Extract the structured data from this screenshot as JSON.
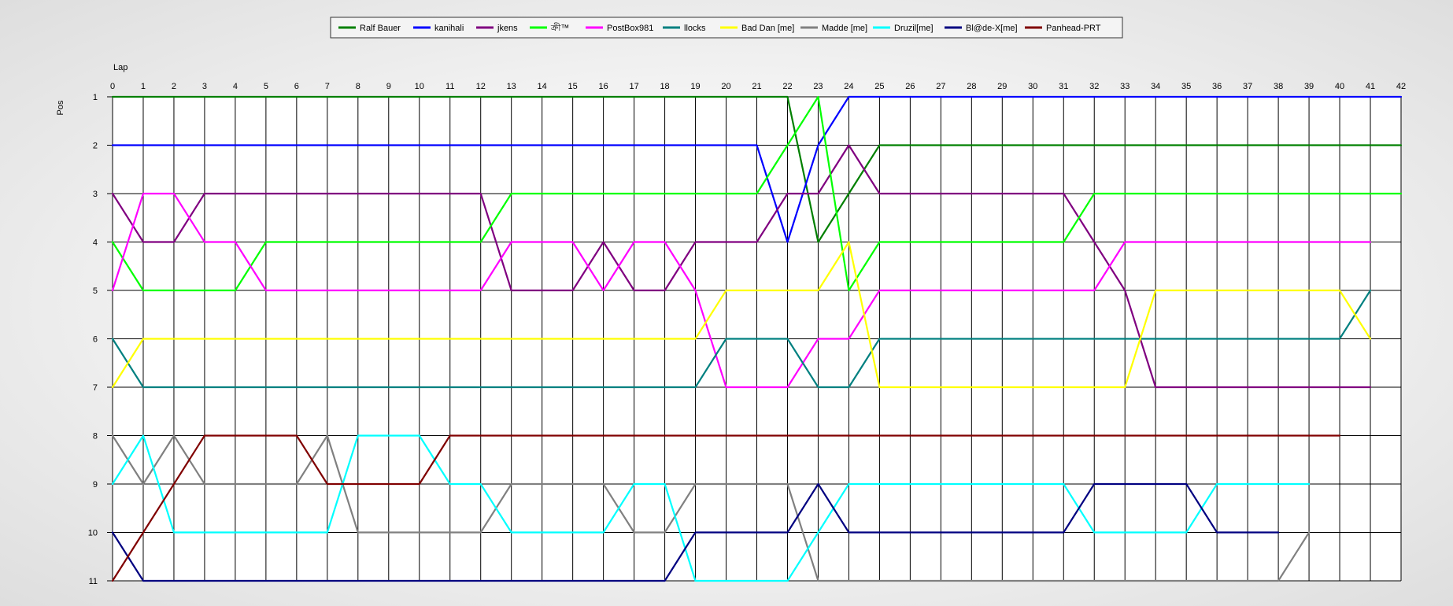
{
  "chart_data": {
    "type": "line",
    "title": "",
    "xlabel": "Lap",
    "ylabel": "Pos",
    "x_ticks": [
      0,
      1,
      2,
      3,
      4,
      5,
      6,
      7,
      8,
      9,
      10,
      11,
      12,
      13,
      14,
      15,
      16,
      17,
      18,
      19,
      20,
      21,
      22,
      23,
      24,
      25,
      26,
      27,
      28,
      29,
      30,
      31,
      32,
      33,
      34,
      35,
      36,
      37,
      38,
      39,
      40,
      41,
      42
    ],
    "y_ticks": [
      1,
      2,
      3,
      4,
      5,
      6,
      7,
      8,
      9,
      10,
      11
    ],
    "xlim": [
      0,
      42
    ],
    "ylim": [
      1,
      11
    ],
    "y_inverted": true,
    "grid": true,
    "legend_position": "top-center",
    "series": [
      {
        "name": "Ralf Bauer",
        "color": "#008000",
        "values": [
          1,
          1,
          1,
          1,
          1,
          1,
          1,
          1,
          1,
          1,
          1,
          1,
          1,
          1,
          1,
          1,
          1,
          1,
          1,
          1,
          1,
          1,
          1,
          4,
          3,
          2,
          2,
          2,
          2,
          2,
          2,
          2,
          2,
          2,
          2,
          2,
          2,
          2,
          2,
          2,
          2,
          2,
          2
        ]
      },
      {
        "name": "kanihali",
        "color": "#0000ff",
        "values": [
          2,
          2,
          2,
          2,
          2,
          2,
          2,
          2,
          2,
          2,
          2,
          2,
          2,
          2,
          2,
          2,
          2,
          2,
          2,
          2,
          2,
          2,
          4,
          2,
          1,
          1,
          1,
          1,
          1,
          1,
          1,
          1,
          1,
          1,
          1,
          1,
          1,
          1,
          1,
          1,
          1,
          1,
          1
        ]
      },
      {
        "name": "jkens",
        "color": "#800080",
        "values": [
          3,
          4,
          4,
          3,
          3,
          3,
          3,
          3,
          3,
          3,
          3,
          3,
          3,
          5,
          5,
          5,
          4,
          5,
          5,
          4,
          4,
          4,
          3,
          3,
          2,
          3,
          3,
          3,
          3,
          3,
          3,
          3,
          4,
          5,
          7,
          7,
          7,
          7,
          7,
          7,
          7,
          7
        ]
      },
      {
        "name": "ক্ৰী™",
        "color": "#00ff00",
        "values": [
          4,
          5,
          5,
          5,
          5,
          4,
          4,
          4,
          4,
          4,
          4,
          4,
          4,
          3,
          3,
          3,
          3,
          3,
          3,
          3,
          3,
          3,
          2,
          1,
          5,
          4,
          4,
          4,
          4,
          4,
          4,
          4,
          3,
          3,
          3,
          3,
          3,
          3,
          3,
          3,
          3,
          3,
          3
        ]
      },
      {
        "name": "PostBox981",
        "color": "#ff00ff",
        "values": [
          5,
          3,
          3,
          4,
          4,
          5,
          5,
          5,
          5,
          5,
          5,
          5,
          5,
          4,
          4,
          4,
          5,
          4,
          4,
          5,
          7,
          7,
          7,
          6,
          6,
          5,
          5,
          5,
          5,
          5,
          5,
          5,
          5,
          4,
          4,
          4,
          4,
          4,
          4,
          4,
          4,
          4
        ]
      },
      {
        "name": "llocks",
        "color": "#008080",
        "values": [
          6,
          7,
          7,
          7,
          7,
          7,
          7,
          7,
          7,
          7,
          7,
          7,
          7,
          7,
          7,
          7,
          7,
          7,
          7,
          7,
          6,
          6,
          6,
          7,
          7,
          6,
          6,
          6,
          6,
          6,
          6,
          6,
          6,
          6,
          6,
          6,
          6,
          6,
          6,
          6,
          6,
          5
        ]
      },
      {
        "name": "Bad Dan [me]",
        "color": "#ffff00",
        "values": [
          7,
          6,
          6,
          6,
          6,
          6,
          6,
          6,
          6,
          6,
          6,
          6,
          6,
          6,
          6,
          6,
          6,
          6,
          6,
          6,
          5,
          5,
          5,
          5,
          4,
          7,
          7,
          7,
          7,
          7,
          7,
          7,
          7,
          7,
          5,
          5,
          5,
          5,
          5,
          5,
          5,
          6
        ]
      },
      {
        "name": "Madde [me]",
        "color": "#808080",
        "values": [
          8,
          9,
          8,
          9,
          9,
          9,
          9,
          8,
          10,
          10,
          10,
          10,
          10,
          9,
          9,
          9,
          9,
          10,
          10,
          9,
          9,
          9,
          9,
          11,
          11,
          11,
          11,
          11,
          11,
          11,
          11,
          11,
          11,
          11,
          11,
          11,
          11,
          11,
          11,
          10
        ]
      },
      {
        "name": "Druzil[me]",
        "color": "#00ffff",
        "values": [
          9,
          8,
          10,
          10,
          10,
          10,
          10,
          10,
          8,
          8,
          8,
          9,
          9,
          10,
          10,
          10,
          10,
          9,
          9,
          11,
          11,
          11,
          11,
          10,
          9,
          9,
          9,
          9,
          9,
          9,
          9,
          9,
          10,
          10,
          10,
          10,
          9,
          9,
          9,
          9
        ]
      },
      {
        "name": "Bl@de-X[me]",
        "color": "#000080",
        "values": [
          10,
          11,
          11,
          11,
          11,
          11,
          11,
          11,
          11,
          11,
          11,
          11,
          11,
          11,
          11,
          11,
          11,
          11,
          11,
          10,
          10,
          10,
          10,
          9,
          10,
          10,
          10,
          10,
          10,
          10,
          10,
          10,
          9,
          9,
          9,
          9,
          10,
          10,
          10
        ]
      },
      {
        "name": "Panhead-PRT",
        "color": "#800000",
        "values": [
          11,
          10,
          9,
          8,
          8,
          8,
          8,
          9,
          9,
          9,
          9,
          8,
          8,
          8,
          8,
          8,
          8,
          8,
          8,
          8,
          8,
          8,
          8,
          8,
          8,
          8,
          8,
          8,
          8,
          8,
          8,
          8,
          8,
          8,
          8,
          8,
          8,
          8,
          8,
          8,
          8
        ]
      }
    ]
  }
}
